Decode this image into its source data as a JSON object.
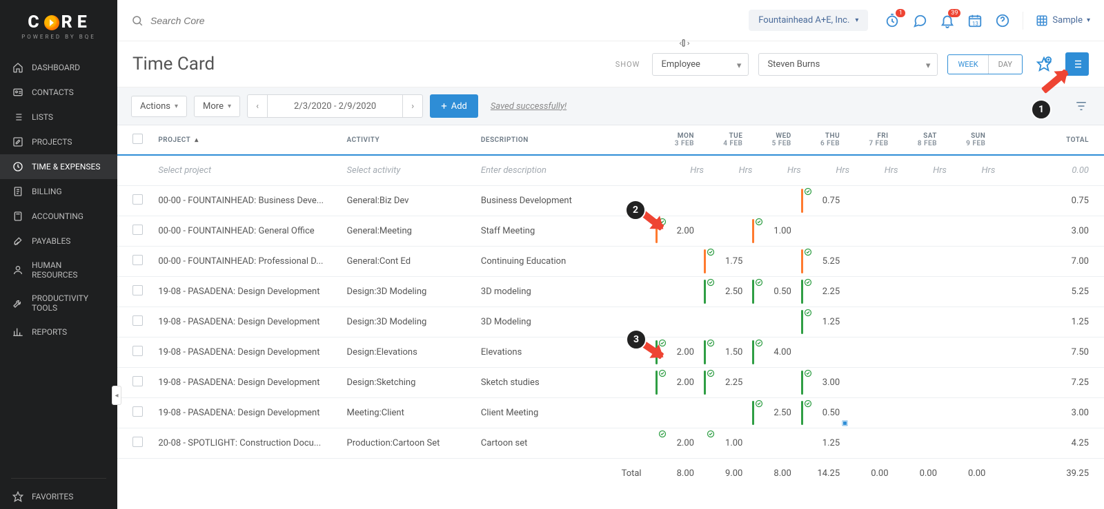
{
  "brand": {
    "name": "CORE",
    "tagline": "POWERED BY BQE"
  },
  "nav": {
    "items": [
      {
        "label": "DASHBOARD",
        "icon": "home-icon"
      },
      {
        "label": "CONTACTS",
        "icon": "card-icon"
      },
      {
        "label": "LISTS",
        "icon": "list-icon"
      },
      {
        "label": "PROJECTS",
        "icon": "edit-square-icon"
      },
      {
        "label": "TIME & EXPENSES",
        "icon": "clock-dollar-icon",
        "active": true
      },
      {
        "label": "BILLING",
        "icon": "invoice-icon"
      },
      {
        "label": "ACCOUNTING",
        "icon": "calculator-icon"
      },
      {
        "label": "PAYABLES",
        "icon": "pen-check-icon"
      },
      {
        "label": "HUMAN RESOURCES",
        "icon": "person-icon"
      },
      {
        "label": "PRODUCTIVITY TOOLS",
        "icon": "wrench-icon"
      },
      {
        "label": "REPORTS",
        "icon": "chart-icon"
      }
    ],
    "fav_label": "FAVORITES"
  },
  "topbar": {
    "search_placeholder": "Search Core",
    "org": "Fountainhead A+E, Inc.",
    "timer_badge": "1",
    "bell_badge": "39",
    "cal_day": "13",
    "sample_label": "Sample"
  },
  "subheader": {
    "page_title": "Time Card",
    "show_label": "SHOW",
    "filter_type": "Employee",
    "person": "Steven Burns",
    "week_label": "WEEK",
    "day_label": "DAY"
  },
  "toolbar": {
    "actions_label": "Actions",
    "more_label": "More",
    "range": "2/3/2020 - 2/9/2020",
    "add_label": "Add",
    "saved_msg": "Saved successfully!"
  },
  "columns": {
    "project": "PROJECT",
    "activity": "ACTIVITY",
    "description": "DESCRIPTION",
    "days": [
      {
        "dow": "MON",
        "date": "3 FEB"
      },
      {
        "dow": "TUE",
        "date": "4 FEB"
      },
      {
        "dow": "WED",
        "date": "5 FEB"
      },
      {
        "dow": "THU",
        "date": "6 FEB"
      },
      {
        "dow": "FRI",
        "date": "7 FEB"
      },
      {
        "dow": "SAT",
        "date": "8 FEB"
      },
      {
        "dow": "SUN",
        "date": "9 FEB"
      }
    ],
    "total": "TOTAL"
  },
  "new_row": {
    "project": "Select project",
    "activity": "Select activity",
    "description": "Enter description",
    "hrs": "Hrs",
    "total": "0.00"
  },
  "rows": [
    {
      "project": "00-00 - FOUNTAINHEAD: Business Deve...",
      "activity": "General:Biz Dev",
      "description": "Business Development",
      "cells": [
        {},
        {},
        {},
        {
          "v": "0.75",
          "bar": "orange",
          "check": true
        },
        {},
        {},
        {}
      ],
      "total": "0.75"
    },
    {
      "project": "00-00 - FOUNTAINHEAD: General Office",
      "activity": "General:Meeting",
      "description": "Staff Meeting",
      "cells": [
        {
          "v": "2.00",
          "bar": "orange",
          "check": true
        },
        {},
        {
          "v": "1.00",
          "bar": "orange",
          "check": true
        },
        {},
        {},
        {},
        {}
      ],
      "total": "3.00"
    },
    {
      "project": "00-00 - FOUNTAINHEAD: Professional D...",
      "activity": "General:Cont Ed",
      "description": "Continuing Education",
      "cells": [
        {},
        {
          "v": "1.75",
          "bar": "orange",
          "check": true
        },
        {},
        {
          "v": "5.25",
          "bar": "orange",
          "check": true
        },
        {},
        {},
        {}
      ],
      "total": "7.00"
    },
    {
      "project": "19-08 - PASADENA: Design Development",
      "activity": "Design:3D Modeling",
      "description": "3D modeling",
      "cells": [
        {},
        {
          "v": "2.50",
          "bar": "green",
          "check": true
        },
        {
          "v": "0.50",
          "bar": "green",
          "check": true
        },
        {
          "v": "2.25",
          "bar": "green",
          "check": true
        },
        {},
        {},
        {}
      ],
      "total": "5.25"
    },
    {
      "project": "19-08 - PASADENA: Design Development",
      "activity": "Design:3D Modeling",
      "description": "3D Modeling",
      "cells": [
        {},
        {},
        {},
        {
          "v": "1.25",
          "bar": "green",
          "check": true
        },
        {},
        {},
        {}
      ],
      "total": "1.25"
    },
    {
      "project": "19-08 - PASADENA: Design Development",
      "activity": "Design:Elevations",
      "description": "Elevations",
      "cells": [
        {
          "v": "2.00",
          "bar": "green",
          "check": true
        },
        {
          "v": "1.50",
          "bar": "green",
          "check": true
        },
        {
          "v": "4.00",
          "bar": "green",
          "check": true
        },
        {},
        {},
        {},
        {}
      ],
      "total": "7.50"
    },
    {
      "project": "19-08 - PASADENA: Design Development",
      "activity": "Design:Sketching",
      "description": "Sketch studies",
      "cells": [
        {
          "v": "2.00",
          "bar": "green",
          "check": true
        },
        {
          "v": "2.25",
          "bar": "green",
          "check": true
        },
        {},
        {
          "v": "3.00",
          "bar": "green",
          "check": true
        },
        {},
        {},
        {}
      ],
      "total": "7.25"
    },
    {
      "project": "19-08 - PASADENA: Design Development",
      "activity": "Meeting:Client",
      "description": "Client Meeting",
      "cells": [
        {},
        {},
        {
          "v": "2.50",
          "bar": "green",
          "check": true
        },
        {
          "v": "0.50",
          "bar": "green",
          "check": true,
          "note": true
        },
        {},
        {},
        {}
      ],
      "total": "3.00"
    },
    {
      "project": "20-08 - SPOTLIGHT: Construction Docu...",
      "activity": "Production:Cartoon Set",
      "description": "Cartoon set",
      "cells": [
        {
          "v": "2.00",
          "check": true
        },
        {
          "v": "1.00",
          "check": true
        },
        {},
        {
          "v": "1.25"
        },
        {},
        {},
        {}
      ],
      "total": "4.25"
    }
  ],
  "totals": {
    "label": "Total",
    "days": [
      "8.00",
      "9.00",
      "8.00",
      "14.25",
      "0.00",
      "0.00",
      "0.00"
    ],
    "grand": "39.25"
  },
  "callouts": {
    "c1": "1",
    "c2": "2",
    "c3": "3"
  }
}
